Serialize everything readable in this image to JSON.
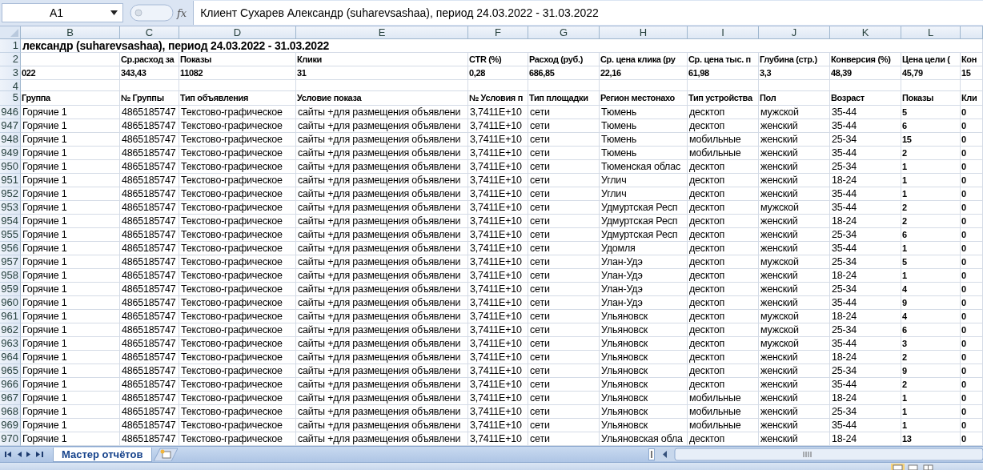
{
  "formula_bar": {
    "name_box": "A1",
    "fx_label": "fx",
    "formula": "Клиент Сухарев Александр (suharevsashaa), период 24.03.2022 - 31.03.2022"
  },
  "columns": [
    "B",
    "C",
    "D",
    "E",
    "F",
    "G",
    "H",
    "I",
    "J",
    "K",
    "L"
  ],
  "rows": [
    {
      "number": "1",
      "kind": "title",
      "cells": [
        "лександр (suharevsashaa), период 24.03.2022 - 31.03.2022"
      ]
    },
    {
      "number": "2",
      "kind": "header",
      "cells": [
        null,
        "Ср.расход за",
        "Показы",
        "Клики",
        "CTR (%)",
        "Расход (руб.)",
        "Ср. цена клика (ру",
        "Ср. цена тыс. п",
        "Глубина (стр.)",
        "Конверсия (%)",
        "Цена цели (",
        "Кон"
      ]
    },
    {
      "number": "3",
      "kind": "header",
      "cells": [
        "022",
        "343,43",
        "11082",
        "31",
        "0,28",
        "686,85",
        "22,16",
        "61,98",
        "3,3",
        "48,39",
        "45,79",
        "15"
      ]
    },
    {
      "number": "4",
      "kind": "header"
    },
    {
      "number": "5",
      "kind": "header",
      "cells": [
        "Группа",
        "№ Группы",
        "Тип объявления",
        "Условие показа",
        "№ Условия п",
        "Тип площадки",
        "Регион местонахо",
        "Тип устройства",
        "Пол",
        "Возраст",
        "Показы",
        "Кли"
      ]
    },
    {
      "number": "946",
      "kind": "data",
      "cells": [
        "Горячие 1",
        "4865185747",
        "Текстово-графическое",
        "сайты +для размещения объявлени",
        "3,7411E+10",
        "сети",
        "Тюмень",
        "десктоп",
        "мужской",
        "35-44",
        "5",
        "0"
      ]
    },
    {
      "number": "947",
      "kind": "data",
      "cells": [
        "Горячие 1",
        "4865185747",
        "Текстово-графическое",
        "сайты +для размещения объявлени",
        "3,7411E+10",
        "сети",
        "Тюмень",
        "десктоп",
        "женский",
        "35-44",
        "6",
        "0"
      ]
    },
    {
      "number": "948",
      "kind": "data",
      "cells": [
        "Горячие 1",
        "4865185747",
        "Текстово-графическое",
        "сайты +для размещения объявлени",
        "3,7411E+10",
        "сети",
        "Тюмень",
        "мобильные",
        "женский",
        "25-34",
        "15",
        "0"
      ]
    },
    {
      "number": "949",
      "kind": "data",
      "cells": [
        "Горячие 1",
        "4865185747",
        "Текстово-графическое",
        "сайты +для размещения объявлени",
        "3,7411E+10",
        "сети",
        "Тюмень",
        "мобильные",
        "женский",
        "35-44",
        "2",
        "0"
      ]
    },
    {
      "number": "950",
      "kind": "data",
      "cells": [
        "Горячие 1",
        "4865185747",
        "Текстово-графическое",
        "сайты +для размещения объявлени",
        "3,7411E+10",
        "сети",
        "Тюменская облас",
        "десктоп",
        "женский",
        "25-34",
        "1",
        "0"
      ]
    },
    {
      "number": "951",
      "kind": "data",
      "cells": [
        "Горячие 1",
        "4865185747",
        "Текстово-графическое",
        "сайты +для размещения объявлени",
        "3,7411E+10",
        "сети",
        "Углич",
        "десктоп",
        "женский",
        "18-24",
        "1",
        "0"
      ]
    },
    {
      "number": "952",
      "kind": "data",
      "cells": [
        "Горячие 1",
        "4865185747",
        "Текстово-графическое",
        "сайты +для размещения объявлени",
        "3,7411E+10",
        "сети",
        "Углич",
        "десктоп",
        "женский",
        "35-44",
        "1",
        "0"
      ]
    },
    {
      "number": "953",
      "kind": "data",
      "cells": [
        "Горячие 1",
        "4865185747",
        "Текстово-графическое",
        "сайты +для размещения объявлени",
        "3,7411E+10",
        "сети",
        "Удмуртская Респ",
        "десктоп",
        "мужской",
        "35-44",
        "2",
        "0"
      ]
    },
    {
      "number": "954",
      "kind": "data",
      "cells": [
        "Горячие 1",
        "4865185747",
        "Текстово-графическое",
        "сайты +для размещения объявлени",
        "3,7411E+10",
        "сети",
        "Удмуртская Респ",
        "десктоп",
        "женский",
        "18-24",
        "2",
        "0"
      ]
    },
    {
      "number": "955",
      "kind": "data",
      "cells": [
        "Горячие 1",
        "4865185747",
        "Текстово-графическое",
        "сайты +для размещения объявлени",
        "3,7411E+10",
        "сети",
        "Удмуртская Респ",
        "десктоп",
        "женский",
        "25-34",
        "6",
        "0"
      ]
    },
    {
      "number": "956",
      "kind": "data",
      "cells": [
        "Горячие 1",
        "4865185747",
        "Текстово-графическое",
        "сайты +для размещения объявлени",
        "3,7411E+10",
        "сети",
        "Удомля",
        "десктоп",
        "женский",
        "35-44",
        "1",
        "0"
      ]
    },
    {
      "number": "957",
      "kind": "data",
      "cells": [
        "Горячие 1",
        "4865185747",
        "Текстово-графическое",
        "сайты +для размещения объявлени",
        "3,7411E+10",
        "сети",
        "Улан-Удэ",
        "десктоп",
        "мужской",
        "25-34",
        "5",
        "0"
      ]
    },
    {
      "number": "958",
      "kind": "data",
      "cells": [
        "Горячие 1",
        "4865185747",
        "Текстово-графическое",
        "сайты +для размещения объявлени",
        "3,7411E+10",
        "сети",
        "Улан-Удэ",
        "десктоп",
        "женский",
        "18-24",
        "1",
        "0"
      ]
    },
    {
      "number": "959",
      "kind": "data",
      "cells": [
        "Горячие 1",
        "4865185747",
        "Текстово-графическое",
        "сайты +для размещения объявлени",
        "3,7411E+10",
        "сети",
        "Улан-Удэ",
        "десктоп",
        "женский",
        "25-34",
        "4",
        "0"
      ]
    },
    {
      "number": "960",
      "kind": "data",
      "cells": [
        "Горячие 1",
        "4865185747",
        "Текстово-графическое",
        "сайты +для размещения объявлени",
        "3,7411E+10",
        "сети",
        "Улан-Удэ",
        "десктоп",
        "женский",
        "35-44",
        "9",
        "0"
      ]
    },
    {
      "number": "961",
      "kind": "data",
      "cells": [
        "Горячие 1",
        "4865185747",
        "Текстово-графическое",
        "сайты +для размещения объявлени",
        "3,7411E+10",
        "сети",
        "Ульяновск",
        "десктоп",
        "мужской",
        "18-24",
        "4",
        "0"
      ]
    },
    {
      "number": "962",
      "kind": "data",
      "cells": [
        "Горячие 1",
        "4865185747",
        "Текстово-графическое",
        "сайты +для размещения объявлени",
        "3,7411E+10",
        "сети",
        "Ульяновск",
        "десктоп",
        "мужской",
        "25-34",
        "6",
        "0"
      ]
    },
    {
      "number": "963",
      "kind": "data",
      "cells": [
        "Горячие 1",
        "4865185747",
        "Текстово-графическое",
        "сайты +для размещения объявлени",
        "3,7411E+10",
        "сети",
        "Ульяновск",
        "десктоп",
        "мужской",
        "35-44",
        "3",
        "0"
      ]
    },
    {
      "number": "964",
      "kind": "data",
      "cells": [
        "Горячие 1",
        "4865185747",
        "Текстово-графическое",
        "сайты +для размещения объявлени",
        "3,7411E+10",
        "сети",
        "Ульяновск",
        "десктоп",
        "женский",
        "18-24",
        "2",
        "0"
      ]
    },
    {
      "number": "965",
      "kind": "data",
      "cells": [
        "Горячие 1",
        "4865185747",
        "Текстово-графическое",
        "сайты +для размещения объявлени",
        "3,7411E+10",
        "сети",
        "Ульяновск",
        "десктоп",
        "женский",
        "25-34",
        "9",
        "0"
      ]
    },
    {
      "number": "966",
      "kind": "data",
      "cells": [
        "Горячие 1",
        "4865185747",
        "Текстово-графическое",
        "сайты +для размещения объявлени",
        "3,7411E+10",
        "сети",
        "Ульяновск",
        "десктоп",
        "женский",
        "35-44",
        "2",
        "0"
      ]
    },
    {
      "number": "967",
      "kind": "data",
      "cells": [
        "Горячие 1",
        "4865185747",
        "Текстово-графическое",
        "сайты +для размещения объявлени",
        "3,7411E+10",
        "сети",
        "Ульяновск",
        "мобильные",
        "женский",
        "18-24",
        "1",
        "0"
      ]
    },
    {
      "number": "968",
      "kind": "data",
      "cells": [
        "Горячие 1",
        "4865185747",
        "Текстово-графическое",
        "сайты +для размещения объявлени",
        "3,7411E+10",
        "сети",
        "Ульяновск",
        "мобильные",
        "женский",
        "25-34",
        "1",
        "0"
      ]
    },
    {
      "number": "969",
      "kind": "data",
      "cells": [
        "Горячие 1",
        "4865185747",
        "Текстово-графическое",
        "сайты +для размещения объявлени",
        "3,7411E+10",
        "сети",
        "Ульяновск",
        "мобильные",
        "женский",
        "35-44",
        "1",
        "0"
      ]
    },
    {
      "number": "970",
      "kind": "data",
      "cells": [
        "Горячие 1",
        "4865185747",
        "Текстово-графическое",
        "сайты +для размещения объявлени",
        "3,7411E+10",
        "сети",
        "Ульяновская обла",
        "десктоп",
        "женский",
        "18-24",
        "13",
        "0"
      ]
    }
  ],
  "sheet_tabs": [
    {
      "label": "Мастер отчётов",
      "selected": true
    }
  ]
}
